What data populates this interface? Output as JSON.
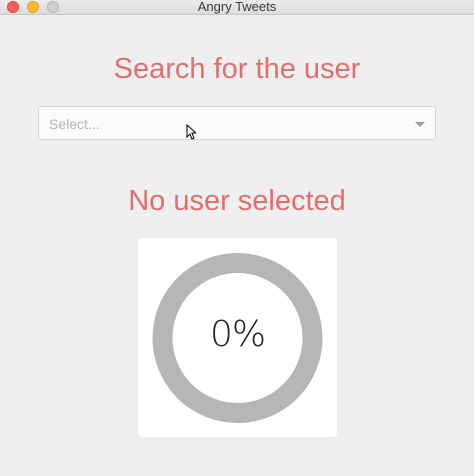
{
  "window": {
    "title": "Angry Tweets"
  },
  "search": {
    "heading": "Search for the user",
    "placeholder": "Select..."
  },
  "status": {
    "heading": "No user selected"
  },
  "progress": {
    "value": 0,
    "label": "0%"
  },
  "colors": {
    "accent": "#e07070",
    "ring": "#b6b6b6",
    "background": "#efefef"
  },
  "icons": {
    "dropdown": "chevron-down-icon",
    "pointer": "mouse-pointer-icon"
  }
}
